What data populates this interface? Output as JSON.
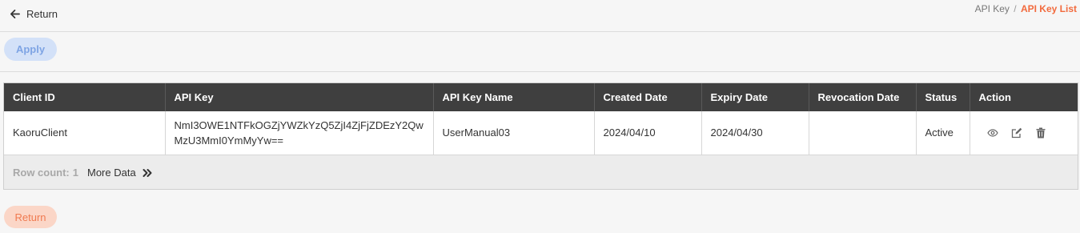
{
  "header": {
    "return_label": "Return",
    "breadcrumb": {
      "parent": "API Key",
      "separator": "/",
      "current": "API Key List"
    }
  },
  "toolbar": {
    "apply_label": "Apply"
  },
  "table": {
    "columns": [
      "Client ID",
      "API Key",
      "API Key Name",
      "Created Date",
      "Expiry Date",
      "Revocation Date",
      "Status",
      "Action"
    ],
    "rows": [
      {
        "client_id": "KaoruClient",
        "api_key": "NmI3OWE1NTFkOGZjYWZkYzQ5ZjI4ZjFjZDEzY2QwMzU3MmI0YmMyYw==",
        "api_key_name": "UserManual03",
        "created_date": "2024/04/10",
        "expiry_date": "2024/04/30",
        "revocation_date": "",
        "status": "Active"
      }
    ],
    "footer": {
      "row_count_label": "Row count:",
      "row_count": "1",
      "more_data_label": "More Data"
    }
  },
  "bottom": {
    "return_label": "Return"
  },
  "colors": {
    "accent_orange": "#f26a3d",
    "apply_bg": "#d3e1f8",
    "apply_text": "#7ea4e4",
    "return_bg": "#fbd6c7",
    "return_text": "#f07a50",
    "header_bg": "#3f3f3f"
  },
  "icons": {
    "return": "arrow-left-icon",
    "view": "eye-icon",
    "edit": "edit-icon",
    "delete": "trash-icon",
    "more": "double-chevron-right-icon"
  }
}
